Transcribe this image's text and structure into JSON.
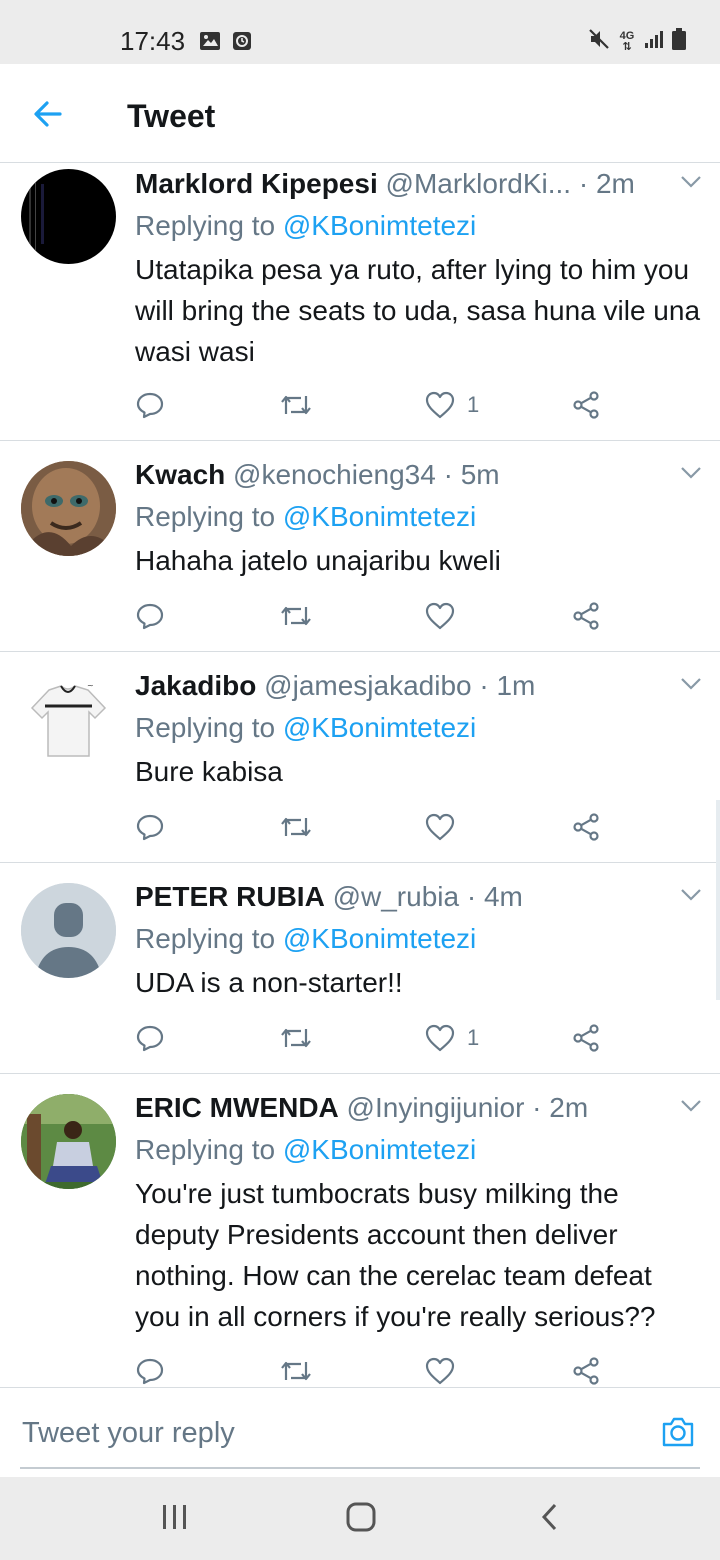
{
  "status_bar": {
    "time": "17:43",
    "network": "4G"
  },
  "header": {
    "title": "Tweet"
  },
  "colors": {
    "accent": "#1da1f2",
    "secondary_text": "#657786",
    "primary_text": "#14171a"
  },
  "tweets": [
    {
      "name": "Marklord Kipepesi",
      "handle": "@MarklordKi...",
      "time": "2m",
      "replying_prefix": "Replying to",
      "replying_to": "@KBonimtetezi",
      "text": "Utatapika pesa ya ruto, after lying to him you will bring the seats to uda, sasa huna vile una wasi wasi",
      "likes": "1",
      "avatar": "black-avatar"
    },
    {
      "name": "Kwach",
      "handle": "@kenochieng34",
      "time": "5m",
      "replying_prefix": "Replying to",
      "replying_to": "@KBonimtetezi",
      "text": "Hahaha jatelo unajaribu kweli",
      "likes": "",
      "avatar": "painted-face-avatar"
    },
    {
      "name": "Jakadibo",
      "handle": "@jamesjakadibo",
      "time": "1m",
      "replying_prefix": "Replying to",
      "replying_to": "@KBonimtetezi",
      "text": "Bure kabisa",
      "likes": "",
      "avatar": "white-shirt-avatar"
    },
    {
      "name": "PETER RUBIA",
      "handle": "@w_rubia",
      "time": "4m",
      "replying_prefix": "Replying to",
      "replying_to": "@KBonimtetezi",
      "text": "UDA is a non-starter!!",
      "likes": "1",
      "avatar": "default-person-avatar"
    },
    {
      "name": "ERIC MWENDA",
      "handle": "@Inyingijunior",
      "time": "2m",
      "replying_prefix": "Replying to",
      "replying_to": "@KBonimtetezi",
      "text": "You're just tumbocrats  busy milking the deputy Presidents account then deliver nothing. How can the cerelac team defeat you in all corners if you're really serious??",
      "likes": "",
      "avatar": "outdoor-photo-avatar"
    }
  ],
  "composer": {
    "placeholder": "Tweet your reply"
  }
}
